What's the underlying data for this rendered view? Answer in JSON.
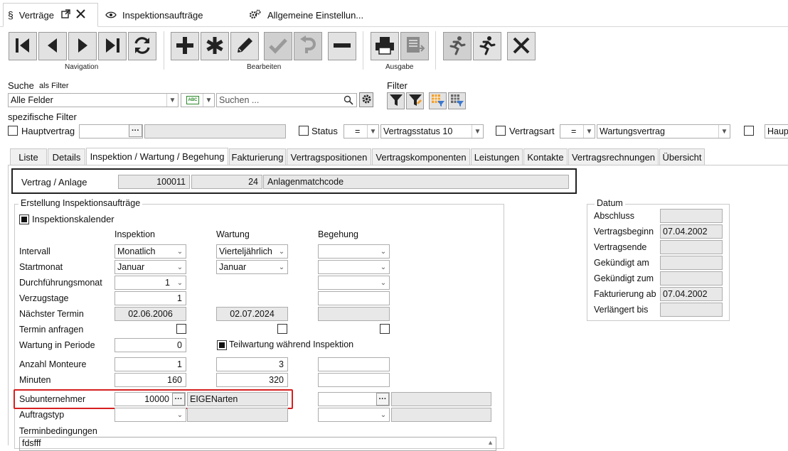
{
  "tabs": [
    {
      "icon": "§",
      "label": "Verträge"
    },
    {
      "icon": "eye",
      "label": "Inspektionsaufträge"
    },
    {
      "icon": "gears",
      "label": "Allgemeine Einstellun..."
    }
  ],
  "toolbar": {
    "groups": {
      "navigation": "Navigation",
      "bearbeiten": "Bearbeiten",
      "ausgabe": "Ausgabe"
    }
  },
  "search": {
    "label": "Suche",
    "mode": "als Filter",
    "field_value": "Alle Felder",
    "placeholder": "Suchen ..."
  },
  "filter": {
    "label": "Filter"
  },
  "specific": {
    "title": "spezifische Filter",
    "hauptvertrag": "Hauptvertrag",
    "status": "Status",
    "status_op": "=",
    "status_value": "Vertragsstatus 10",
    "vertragsart": "Vertragsart",
    "vertragsart_op": "=",
    "vertragsart_value": "Wartungsvertrag",
    "haupt_short": "Haup"
  },
  "page_tabs": [
    "Liste",
    "Details",
    "Inspektion / Wartung / Begehung",
    "Fakturierung",
    "Vertragspositionen",
    "Vertragskomponenten",
    "Leistungen",
    "Kontakte",
    "Vertragsrechnungen",
    "Übersicht"
  ],
  "contract": {
    "label": "Vertrag / Anlage",
    "number": "100011",
    "pos": "24",
    "match": "Anlagenmatchcode"
  },
  "erstellung": {
    "title": "Erstellung Inspektionsaufträge",
    "kalender": "Inspektionskalender",
    "col_inspektion": "Inspektion",
    "col_wartung": "Wartung",
    "col_begehung": "Begehung",
    "rows": {
      "intervall": "Intervall",
      "startmonat": "Startmonat",
      "durchfuehrung": "Durchführungsmonat",
      "verzug": "Verzugstage",
      "naechster": "Nächster Termin",
      "termin_anfragen": "Termin anfragen",
      "wartung_periode": "Wartung in Periode",
      "anzahl": "Anzahl Monteure",
      "minuten": "Minuten",
      "sub": "Subunternehmer",
      "auftragstyp": "Auftragstyp",
      "terminbed": "Terminbedingungen"
    },
    "insp": {
      "intervall": "Monatlich",
      "startmonat": "Januar",
      "durchfuehrung": "1",
      "verzug": "1",
      "naechster": "02.06.2006",
      "wartung_periode": "0",
      "anzahl": "1",
      "minuten": "160",
      "sub_nr": "10000",
      "sub_name": "EIGENarten"
    },
    "wart": {
      "intervall": "Vierteljährlich",
      "startmonat": "Januar",
      "naechster": "02.07.2024",
      "teilwartung": "Teilwartung während Inspektion",
      "anzahl": "3",
      "minuten": "320"
    },
    "terminbed_value": "fdsfff"
  },
  "datum": {
    "title": "Datum",
    "rows": [
      {
        "label": "Abschluss",
        "value": ""
      },
      {
        "label": "Vertragsbeginn",
        "value": "07.04.2002"
      },
      {
        "label": "Vertragsende",
        "value": ""
      },
      {
        "label": "Gekündigt am",
        "value": ""
      },
      {
        "label": "Gekündigt zum",
        "value": ""
      },
      {
        "label": "Fakturierung ab",
        "value": "07.04.2002"
      },
      {
        "label": "Verlängert bis",
        "value": ""
      }
    ]
  },
  "colors": {
    "highlight": "#d62020",
    "accent_orange": "#f0a030",
    "icon_dark": "#222222"
  }
}
